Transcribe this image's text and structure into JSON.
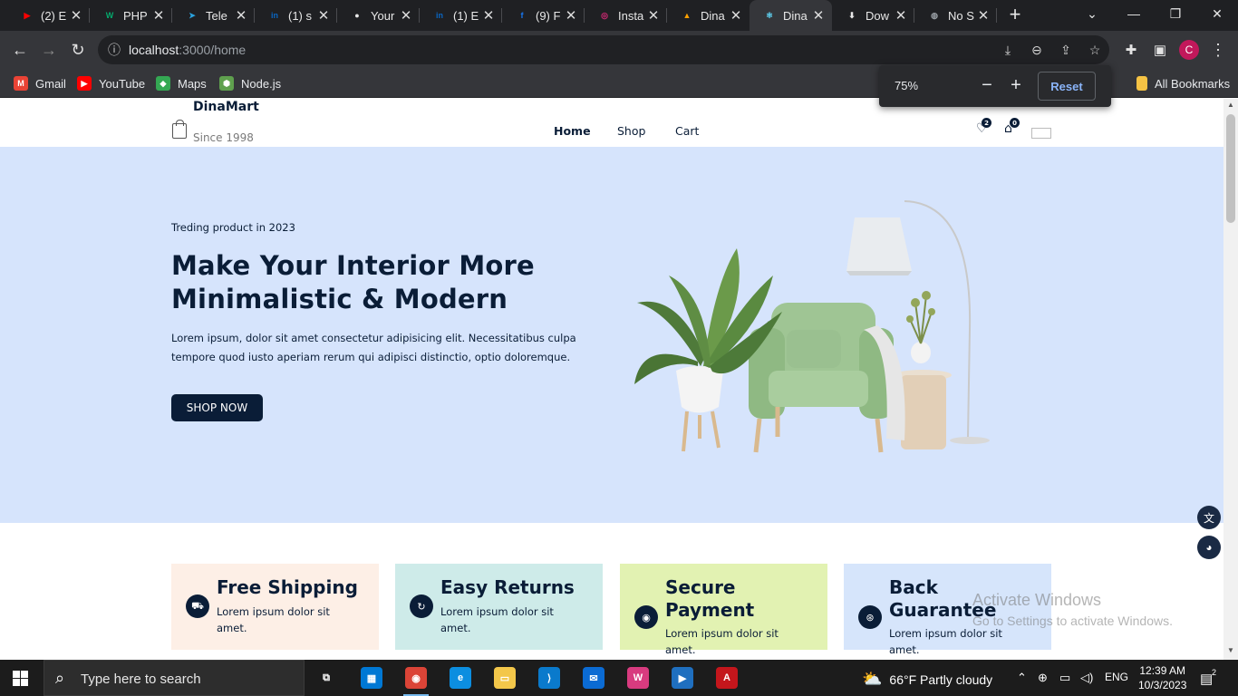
{
  "browser": {
    "tabs": [
      {
        "title": "(2) E",
        "favicon": "youtube-icon",
        "color": "#ff0000",
        "glyph": "▶"
      },
      {
        "title": "PHP",
        "favicon": "w3schools-icon",
        "color": "#04aa6d",
        "glyph": "W"
      },
      {
        "title": "Tele",
        "favicon": "telegram-icon",
        "color": "#2aa3df",
        "glyph": "➤"
      },
      {
        "title": "(1) s",
        "favicon": "linkedin-icon",
        "color": "#0a66c2",
        "glyph": "in"
      },
      {
        "title": "Your",
        "favicon": "github-icon",
        "color": "#e8e8e8",
        "glyph": "●"
      },
      {
        "title": "(1) E",
        "favicon": "linkedin-icon",
        "color": "#0a66c2",
        "glyph": "in"
      },
      {
        "title": "(9) F",
        "favicon": "facebook-icon",
        "color": "#1877f2",
        "glyph": "f"
      },
      {
        "title": "Insta",
        "favicon": "instagram-icon",
        "color": "#d62976",
        "glyph": "◎"
      },
      {
        "title": "Dina",
        "favicon": "firebase-icon",
        "color": "#ffa000",
        "glyph": "▲"
      },
      {
        "title": "Dina",
        "favicon": "react-icon",
        "color": "#61dafb",
        "glyph": "⚛"
      },
      {
        "title": "Dow",
        "favicon": "download-icon",
        "color": "#e8e8e8",
        "glyph": "⬇"
      },
      {
        "title": "No S",
        "favicon": "globe-icon",
        "color": "#9aa0a6",
        "glyph": "◍"
      }
    ],
    "active_tab": 9,
    "url_host": "localhost",
    "url_path": ":3000/home",
    "profile_initial": "C",
    "bookmarks": [
      {
        "label": "Gmail",
        "icon": "gmail-icon",
        "color": "#ea4335",
        "glyph": "M"
      },
      {
        "label": "YouTube",
        "icon": "youtube-icon",
        "color": "#ff0000",
        "glyph": "▶"
      },
      {
        "label": "Maps",
        "icon": "maps-icon",
        "color": "#34a853",
        "glyph": "◆"
      },
      {
        "label": "Node.js",
        "icon": "nodejs-icon",
        "color": "#5fa04e",
        "glyph": "⬢"
      }
    ],
    "all_bookmarks": "All Bookmarks",
    "zoom": {
      "level": "75%",
      "reset": "Reset"
    }
  },
  "site": {
    "brand": {
      "name": "DinaMart",
      "since": "Since 1998"
    },
    "nav": [
      {
        "label": "Home",
        "active": true
      },
      {
        "label": "Shop",
        "active": false
      },
      {
        "label": "Cart",
        "active": false
      }
    ],
    "wishlist_count": "2",
    "cart_count": "0",
    "hero": {
      "subtitle": "Treding product in 2023",
      "title": "Make Your Interior More Minimalistic & Modern",
      "text": "Lorem ipsum, dolor sit amet consectetur adipisicing elit. Necessitatibus culpa tempore quod iusto aperiam rerum qui adipisci distinctio, optio doloremque.",
      "button": "SHOP NOW"
    },
    "services": [
      {
        "title": "Free Shipping",
        "text": "Lorem ipsum dolor sit amet.",
        "bg": "#fdefe6",
        "icon": "truck-icon",
        "glyph": "⛟"
      },
      {
        "title": "Easy Returns",
        "text": "Lorem ipsum dolor sit amet.",
        "bg": "#ceebe9",
        "icon": "refresh-icon",
        "glyph": "↻"
      },
      {
        "title": "Secure Payment",
        "text": "Lorem ipsum dolor sit amet.",
        "bg": "#e2f2b2",
        "icon": "secure-icon",
        "glyph": "◉"
      },
      {
        "title": "Back Guarantee",
        "text": "Lorem ipsum dolor sit amet.",
        "bg": "#d6e5fb",
        "icon": "guarantee-icon",
        "glyph": "⊛"
      }
    ]
  },
  "windows": {
    "activate_title": "Activate Windows",
    "activate_sub": "Go to Settings to activate Windows.",
    "search_placeholder": "Type here to search",
    "weather": "66°F  Partly cloudy",
    "language": "ENG",
    "time": "12:39 AM",
    "date": "10/3/2023",
    "notification_count": "2",
    "taskbar_apps": [
      {
        "name": "task-view-icon",
        "color": "transparent",
        "glyph": "⧉"
      },
      {
        "name": "microsoft-store-icon",
        "color": "#0078d4",
        "glyph": "▦"
      },
      {
        "name": "chrome-icon",
        "color": "#db4437",
        "glyph": "◉"
      },
      {
        "name": "edge-icon",
        "color": "#0c8ee0",
        "glyph": "e"
      },
      {
        "name": "file-explorer-icon",
        "color": "#f3c74a",
        "glyph": "▭"
      },
      {
        "name": "vscode-icon",
        "color": "#0a7acc",
        "glyph": "⟩"
      },
      {
        "name": "mail-icon",
        "color": "#0b6bd3",
        "glyph": "✉"
      },
      {
        "name": "wps-office-icon",
        "color": "#d83b7f",
        "glyph": "W"
      },
      {
        "name": "media-app-icon",
        "color": "#1f6fbf",
        "glyph": "▶"
      },
      {
        "name": "acrobat-icon",
        "color": "#c4161c",
        "glyph": "A"
      }
    ]
  }
}
